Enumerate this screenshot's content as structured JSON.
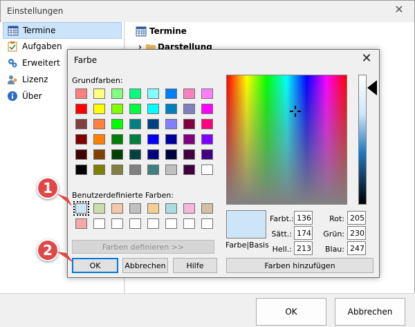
{
  "outer": {
    "title": "Einstellungen",
    "sidebar": [
      "Termine",
      "Aufgaben",
      "Erweitert",
      "Lizenz",
      "Über"
    ],
    "pane_title": "Termine",
    "pane_subtitle": "Darstellung",
    "ok_label": "OK",
    "cancel_label": "Abbrechen"
  },
  "dialog": {
    "title": "Farbe",
    "basic_label": "Grundfarben:",
    "custom_label": "Benutzerdefinierte Farben:",
    "define_label": "Farben definieren >>",
    "ok_label": "OK",
    "cancel_label": "Abbrechen",
    "help_label": "Hilfe",
    "preview_label": "Farbe|Basis",
    "add_label": "Farben hinzufügen",
    "fields": {
      "hue_label": "Farbt.:",
      "hue": "136",
      "sat_label": "Sätt.:",
      "sat": "174",
      "lum_label": "Hell.:",
      "lum": "213",
      "red_label": "Rot:",
      "red": "205",
      "green_label": "Grün:",
      "green": "230",
      "blue_label": "Blau:",
      "blue": "247"
    },
    "basic_colors": [
      [
        "#ff8080",
        "#ffff80",
        "#80ff80",
        "#00ff80",
        "#80ffff",
        "#0080ff",
        "#ff80c0",
        "#ff80ff"
      ],
      [
        "#ff0000",
        "#ffff00",
        "#80ff00",
        "#00ff40",
        "#00ffff",
        "#0080c0",
        "#8080c0",
        "#ff00ff"
      ],
      [
        "#804040",
        "#ff8040",
        "#00ff00",
        "#008080",
        "#004080",
        "#8080ff",
        "#800040",
        "#ff0080"
      ],
      [
        "#800000",
        "#ff8000",
        "#008000",
        "#008040",
        "#0000ff",
        "#0000a0",
        "#800080",
        "#8000ff"
      ],
      [
        "#400000",
        "#804000",
        "#004000",
        "#004040",
        "#000080",
        "#000040",
        "#400040",
        "#400080"
      ],
      [
        "#000000",
        "#808000",
        "#808040",
        "#808080",
        "#408080",
        "#c0c0c0",
        "#400040",
        "#ffffff"
      ]
    ],
    "custom_colors": [
      [
        "#cde6f7",
        "#c8e0a8",
        "#f4c8a8",
        "#c0c0c0",
        "#f4d090",
        "#a8dce0",
        "#f4b8d8",
        "#d0c0a8"
      ],
      [
        "#f4a8a8",
        "#ffffff",
        "#ffffff",
        "#ffffff",
        "#ffffff",
        "#ffffff",
        "#ffffff",
        "#ffffff"
      ]
    ]
  },
  "callouts": [
    "1",
    "2"
  ]
}
